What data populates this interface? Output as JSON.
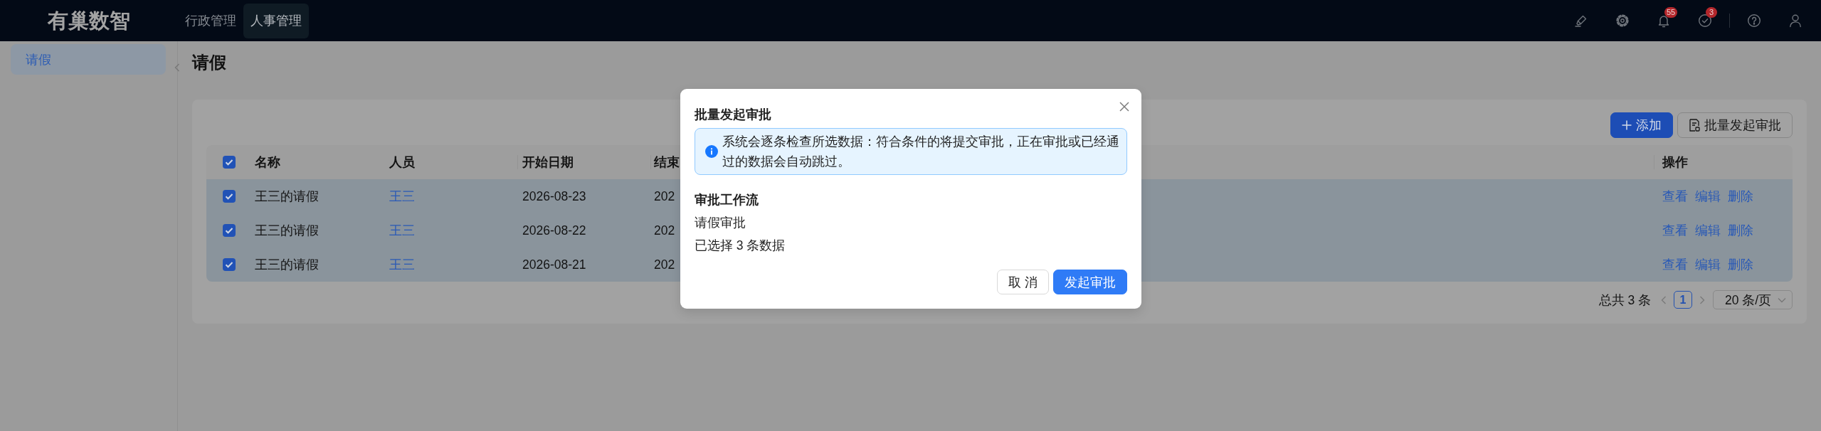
{
  "header": {
    "logo": "有巢数智",
    "nav": [
      {
        "label": "行政管理",
        "selected": false
      },
      {
        "label": "人事管理",
        "selected": true
      }
    ],
    "notification_count": "55",
    "task_count": "3"
  },
  "sidebar": {
    "items": [
      {
        "label": "请假",
        "selected": true
      }
    ]
  },
  "page": {
    "title": "请假"
  },
  "toolbar": {
    "buttons": [
      {
        "label": "添加",
        "kind": "primary"
      },
      {
        "label": "批量发起审批",
        "kind": "default"
      }
    ]
  },
  "table": {
    "all_selected": true,
    "columns": [
      "名称",
      "人员",
      "开始日期",
      "结束",
      "操作"
    ],
    "rows": [
      {
        "selected": true,
        "name": "王三的请假",
        "person": "王三",
        "start_date": "2026-08-23",
        "column_4": "202",
        "actions": [
          "查看",
          "编辑",
          "删除"
        ]
      },
      {
        "selected": true,
        "name": "王三的请假",
        "person": "王三",
        "start_date": "2026-08-22",
        "column_4": "202",
        "actions": [
          "查看",
          "编辑",
          "删除"
        ]
      },
      {
        "selected": true,
        "name": "王三的请假",
        "person": "王三",
        "start_date": "2026-08-21",
        "column_4": "202",
        "actions": [
          "查看",
          "编辑",
          "删除"
        ]
      }
    ]
  },
  "pagination": {
    "total": "总共 3 条",
    "pages": [
      {
        "label": "1",
        "selected": true
      }
    ],
    "page_size": "20 条/页"
  },
  "modal": {
    "title": "批量发起审批",
    "notice": "系统会逐条检查所选数据：符合条件的将提交审批，正在审批或已经通过的数据会自动跳过。",
    "section_title": "审批工作流",
    "workflow": "请假审批",
    "selection": "已选择 3 条数据",
    "buttons": [
      {
        "label": "取 消",
        "kind": "default"
      },
      {
        "label": "发起审批",
        "kind": "primary"
      }
    ]
  }
}
